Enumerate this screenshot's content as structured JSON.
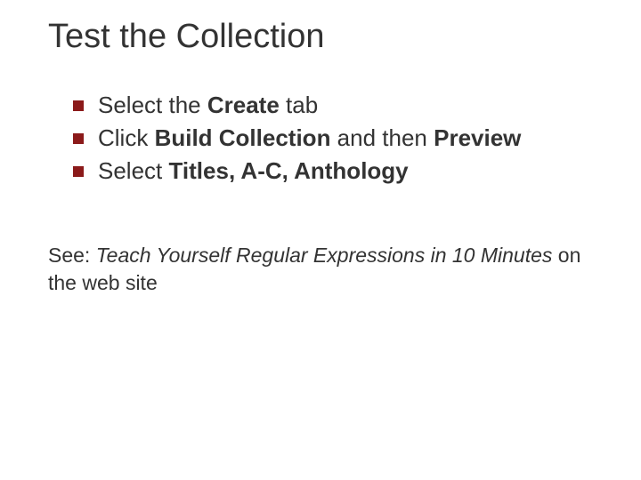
{
  "title": "Test the Collection",
  "bullets": [
    {
      "pre": "Select the ",
      "b1": "Create",
      "mid": " tab",
      "b2": "",
      "post": ""
    },
    {
      "pre": "Click ",
      "b1": "Build Collection",
      "mid": " and then ",
      "b2": "Preview",
      "post": ""
    },
    {
      "pre": "Select ",
      "b1": "Titles, A-C, Anthology",
      "mid": "",
      "b2": "",
      "post": ""
    }
  ],
  "see": {
    "pre": "See: ",
    "italic": "Teach Yourself Regular Expressions in 10 Minutes",
    "post": " on the web site"
  }
}
